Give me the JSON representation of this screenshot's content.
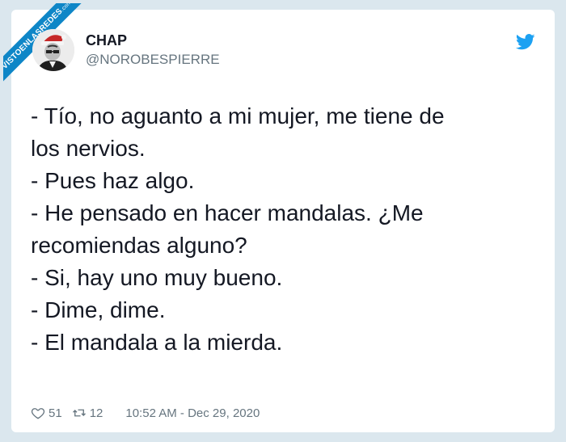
{
  "watermark": {
    "text": "VISTOENLASREDES",
    "sub": ".com"
  },
  "author": {
    "name": "CHAP",
    "handle": "@NOROBESPIERRE"
  },
  "tweet": {
    "lines": [
      "- Tío, no aguanto a mi mujer, me tiene de",
      "los nervios.",
      "- Pues haz algo.",
      "- He pensado en hacer mandalas. ¿Me",
      "recomiendas alguno?",
      "- Si, hay uno muy bueno.",
      "- Dime, dime.",
      "- El mandala a la mierda."
    ]
  },
  "stats": {
    "likes": "51",
    "retweets": "12",
    "timestamp": "10:52 AM - Dec 29, 2020"
  },
  "icons": {
    "like": "heart-icon",
    "retweet": "retweet-icon",
    "brand": "twitter-bird-icon"
  },
  "colors": {
    "background": "#dbe7ee",
    "card": "#ffffff",
    "text": "#141823",
    "muted": "#66757f",
    "twitter_blue": "#1da1f2",
    "ribbon": "#0e86c7"
  }
}
